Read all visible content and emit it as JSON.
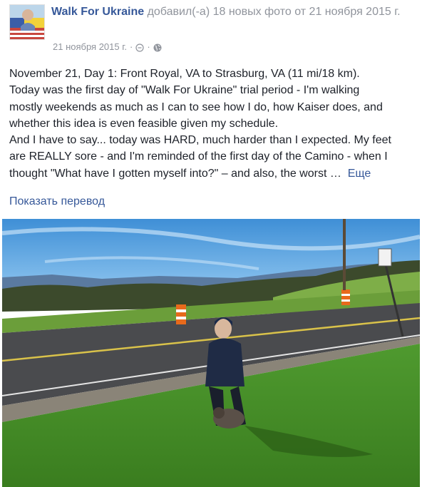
{
  "header": {
    "page_name": "Walk For Ukraine",
    "action_text": "добавил(-а) 18 новых фото от 21 ноября 2015 г.",
    "timestamp": "21 ноября 2015 г.",
    "separator": "·",
    "clock_icon": "clock-icon",
    "privacy_icon": "globe-icon"
  },
  "post": {
    "lines": [
      "November 21, Day 1: Front Royal, VA to Strasburg, VA (11 mi/18 km).",
      "Today was the first day of \"Walk For Ukraine\" trial period - I'm walking",
      "mostly weekends as much as I can to see how I do, how Kaiser does, and",
      "whether this idea is even feasible given my schedule.",
      "And I have to say... today was HARD, much harder than I expected. My feet",
      "are REALLY sore - and I'm reminded of the first day of the Camino - when I",
      "thought \"What have I gotten myself into?\" – and also, the worst …"
    ],
    "more_label": "Еще",
    "translate_label": "Показать перевод"
  },
  "colors": {
    "link": "#365899",
    "text": "#1d2129",
    "meta": "#90949c"
  }
}
